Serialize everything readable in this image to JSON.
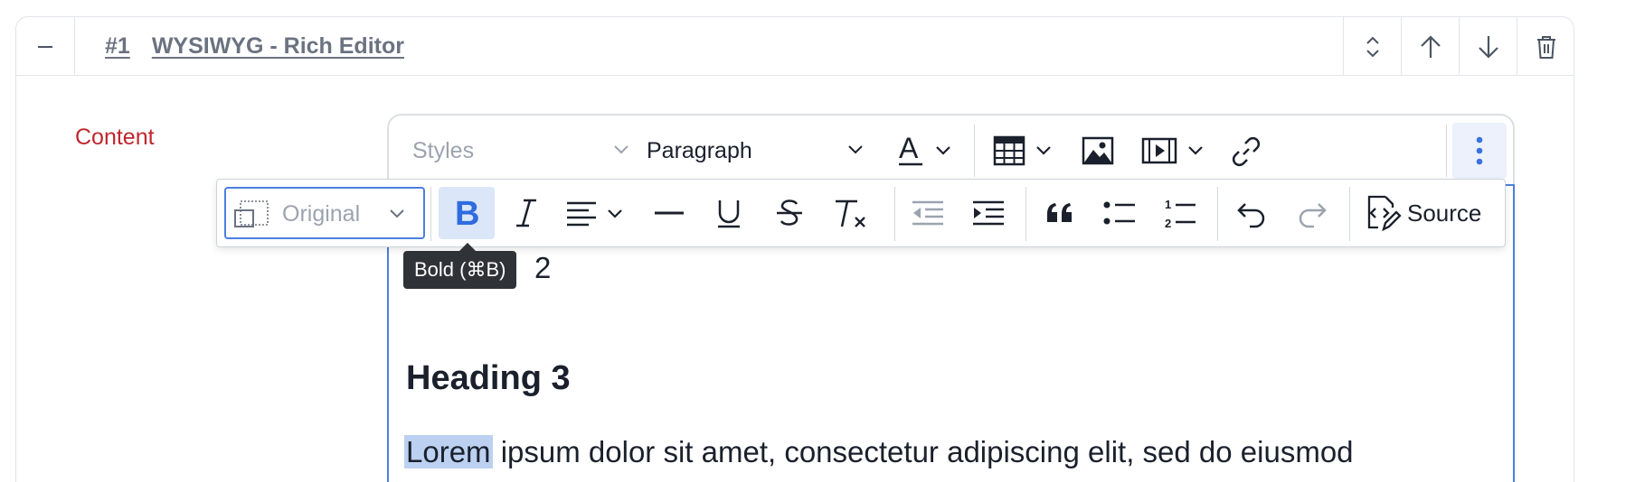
{
  "block": {
    "number": "#1",
    "title": "WYSIWYG - Rich Editor",
    "header_buttons": [
      {
        "icon": "chevron-up-down-icon"
      },
      {
        "icon": "arrow-up-icon"
      },
      {
        "icon": "arrow-down-icon"
      },
      {
        "icon": "trash-icon"
      }
    ]
  },
  "field": {
    "label": "Content"
  },
  "toolbar": {
    "styles_placeholder": "Styles",
    "heading_value": "Paragraph",
    "icons": [
      "font-color-icon",
      "table-icon",
      "image-icon",
      "media-icon",
      "link-icon",
      "more-vertical-icon"
    ]
  },
  "image_toolbar": {
    "resize_value": "Original",
    "source_label": "Source",
    "buttons": [
      "bold-icon",
      "italic-icon",
      "align-left-icon",
      "horizontal-line-icon",
      "underline-icon",
      "strikethrough-icon",
      "remove-format-icon",
      "outdent-icon",
      "indent-icon",
      "blockquote-icon",
      "bulleted-list-icon",
      "numbered-list-icon",
      "undo-icon",
      "redo-icon",
      "source-icon"
    ]
  },
  "tooltip": {
    "text": "Bold (⌘B)"
  },
  "content": {
    "heading2_visible": "2",
    "heading3": "Heading 3",
    "paragraph_selected": "Lorem",
    "paragraph_rest": " ipsum dolor sit amet, consectetur adipiscing elit, sed do eiusmod"
  },
  "colors": {
    "accent": "#4a7fe0",
    "label_red": "#c0272d",
    "title_gray": "#6b7280"
  }
}
